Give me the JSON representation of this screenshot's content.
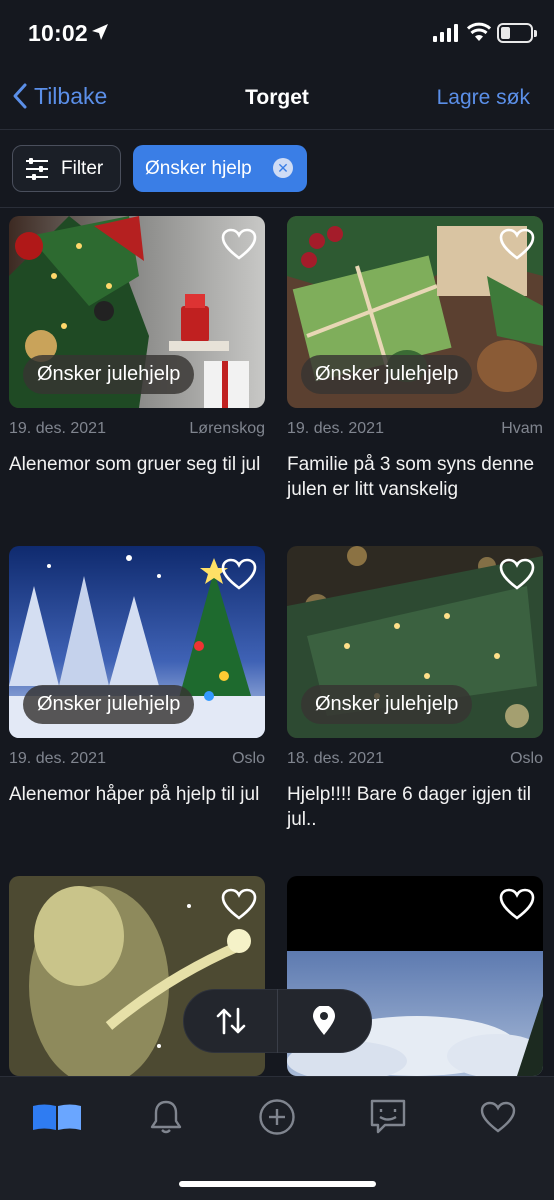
{
  "status_bar": {
    "time": "10:02"
  },
  "nav": {
    "back_label": "Tilbake",
    "title": "Torget",
    "save_search_label": "Lagre søk"
  },
  "filters": {
    "filter_label": "Filter",
    "active_chip": "Ønsker hjelp"
  },
  "listings": [
    {
      "badge": "Ønsker julehjelp",
      "date": "19. des. 2021",
      "location": "Lørenskog",
      "title": "Alenemor som gruer seg til jul"
    },
    {
      "badge": "Ønsker julehjelp",
      "date": "19. des. 2021",
      "location": "Hvam",
      "title": "Familie på 3 som syns denne julen er litt vanskelig"
    },
    {
      "badge": "Ønsker julehjelp",
      "date": "19. des. 2021",
      "location": "Oslo",
      "title": "Alenemor håper på hjelp til jul"
    },
    {
      "badge": "Ønsker julehjelp",
      "date": "18. des. 2021",
      "location": "Oslo",
      "title": "Hjelp!!!! Bare 6 dager igjen til jul.."
    }
  ],
  "tabs": [
    {
      "icon": "book-icon",
      "active": true
    },
    {
      "icon": "bell-icon",
      "active": false
    },
    {
      "icon": "plus-circle-icon",
      "active": false
    },
    {
      "icon": "chat-smile-icon",
      "active": false
    },
    {
      "icon": "heart-icon",
      "active": false
    }
  ],
  "colors": {
    "background": "#15181f",
    "accent": "#5b8fe8",
    "chip": "#3a7ee6",
    "tab_active": "#2f7cf2"
  }
}
